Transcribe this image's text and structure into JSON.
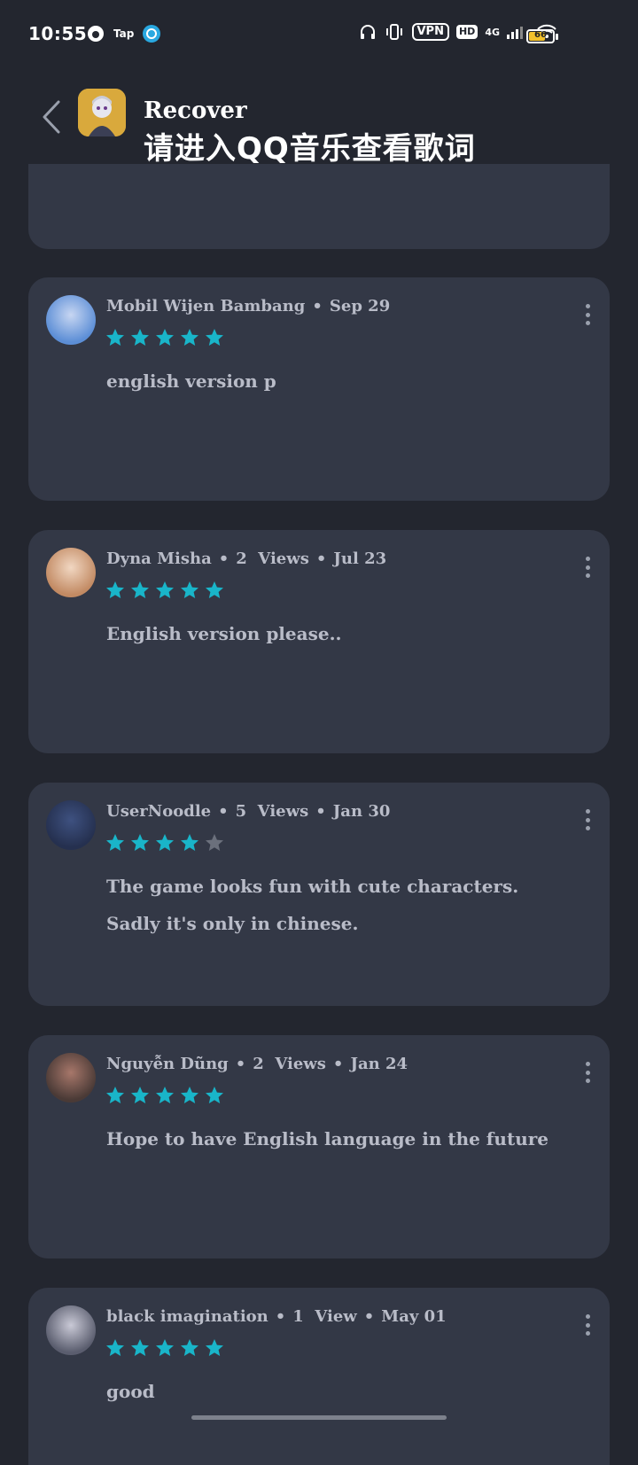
{
  "status_bar": {
    "time": "10:55",
    "tap_label": "Tap",
    "vpn": "VPN",
    "hd": "HD",
    "network": "4G",
    "battery": "66"
  },
  "header": {
    "title": "Recover",
    "subtitle": "请进入QQ音乐查看歌词"
  },
  "colors": {
    "background": "#23262f",
    "card": "#333846",
    "star_filled": "#19b5c9",
    "star_empty": "#6b707c"
  },
  "reviews": [
    {
      "author": "Mobil Wijen Bambang",
      "meta_extra": "",
      "date": "Sep 29",
      "rating": 5,
      "text": "english version p"
    },
    {
      "author": "Dyna Misha",
      "meta_extra": "2  Views",
      "date": "Jul 23",
      "rating": 5,
      "text": "English version please.."
    },
    {
      "author": "UserNoodle",
      "meta_extra": "5  Views",
      "date": "Jan 30",
      "rating": 4,
      "text": "The game looks fun with cute characters. Sadly it's only in chinese."
    },
    {
      "author": "Nguyễn Dũng",
      "meta_extra": "2  Views",
      "date": "Jan 24",
      "rating": 5,
      "text": "Hope to have English language in the future"
    },
    {
      "author": "black imagination",
      "meta_extra": "1  View",
      "date": "May 01",
      "rating": 5,
      "text": "good"
    }
  ]
}
